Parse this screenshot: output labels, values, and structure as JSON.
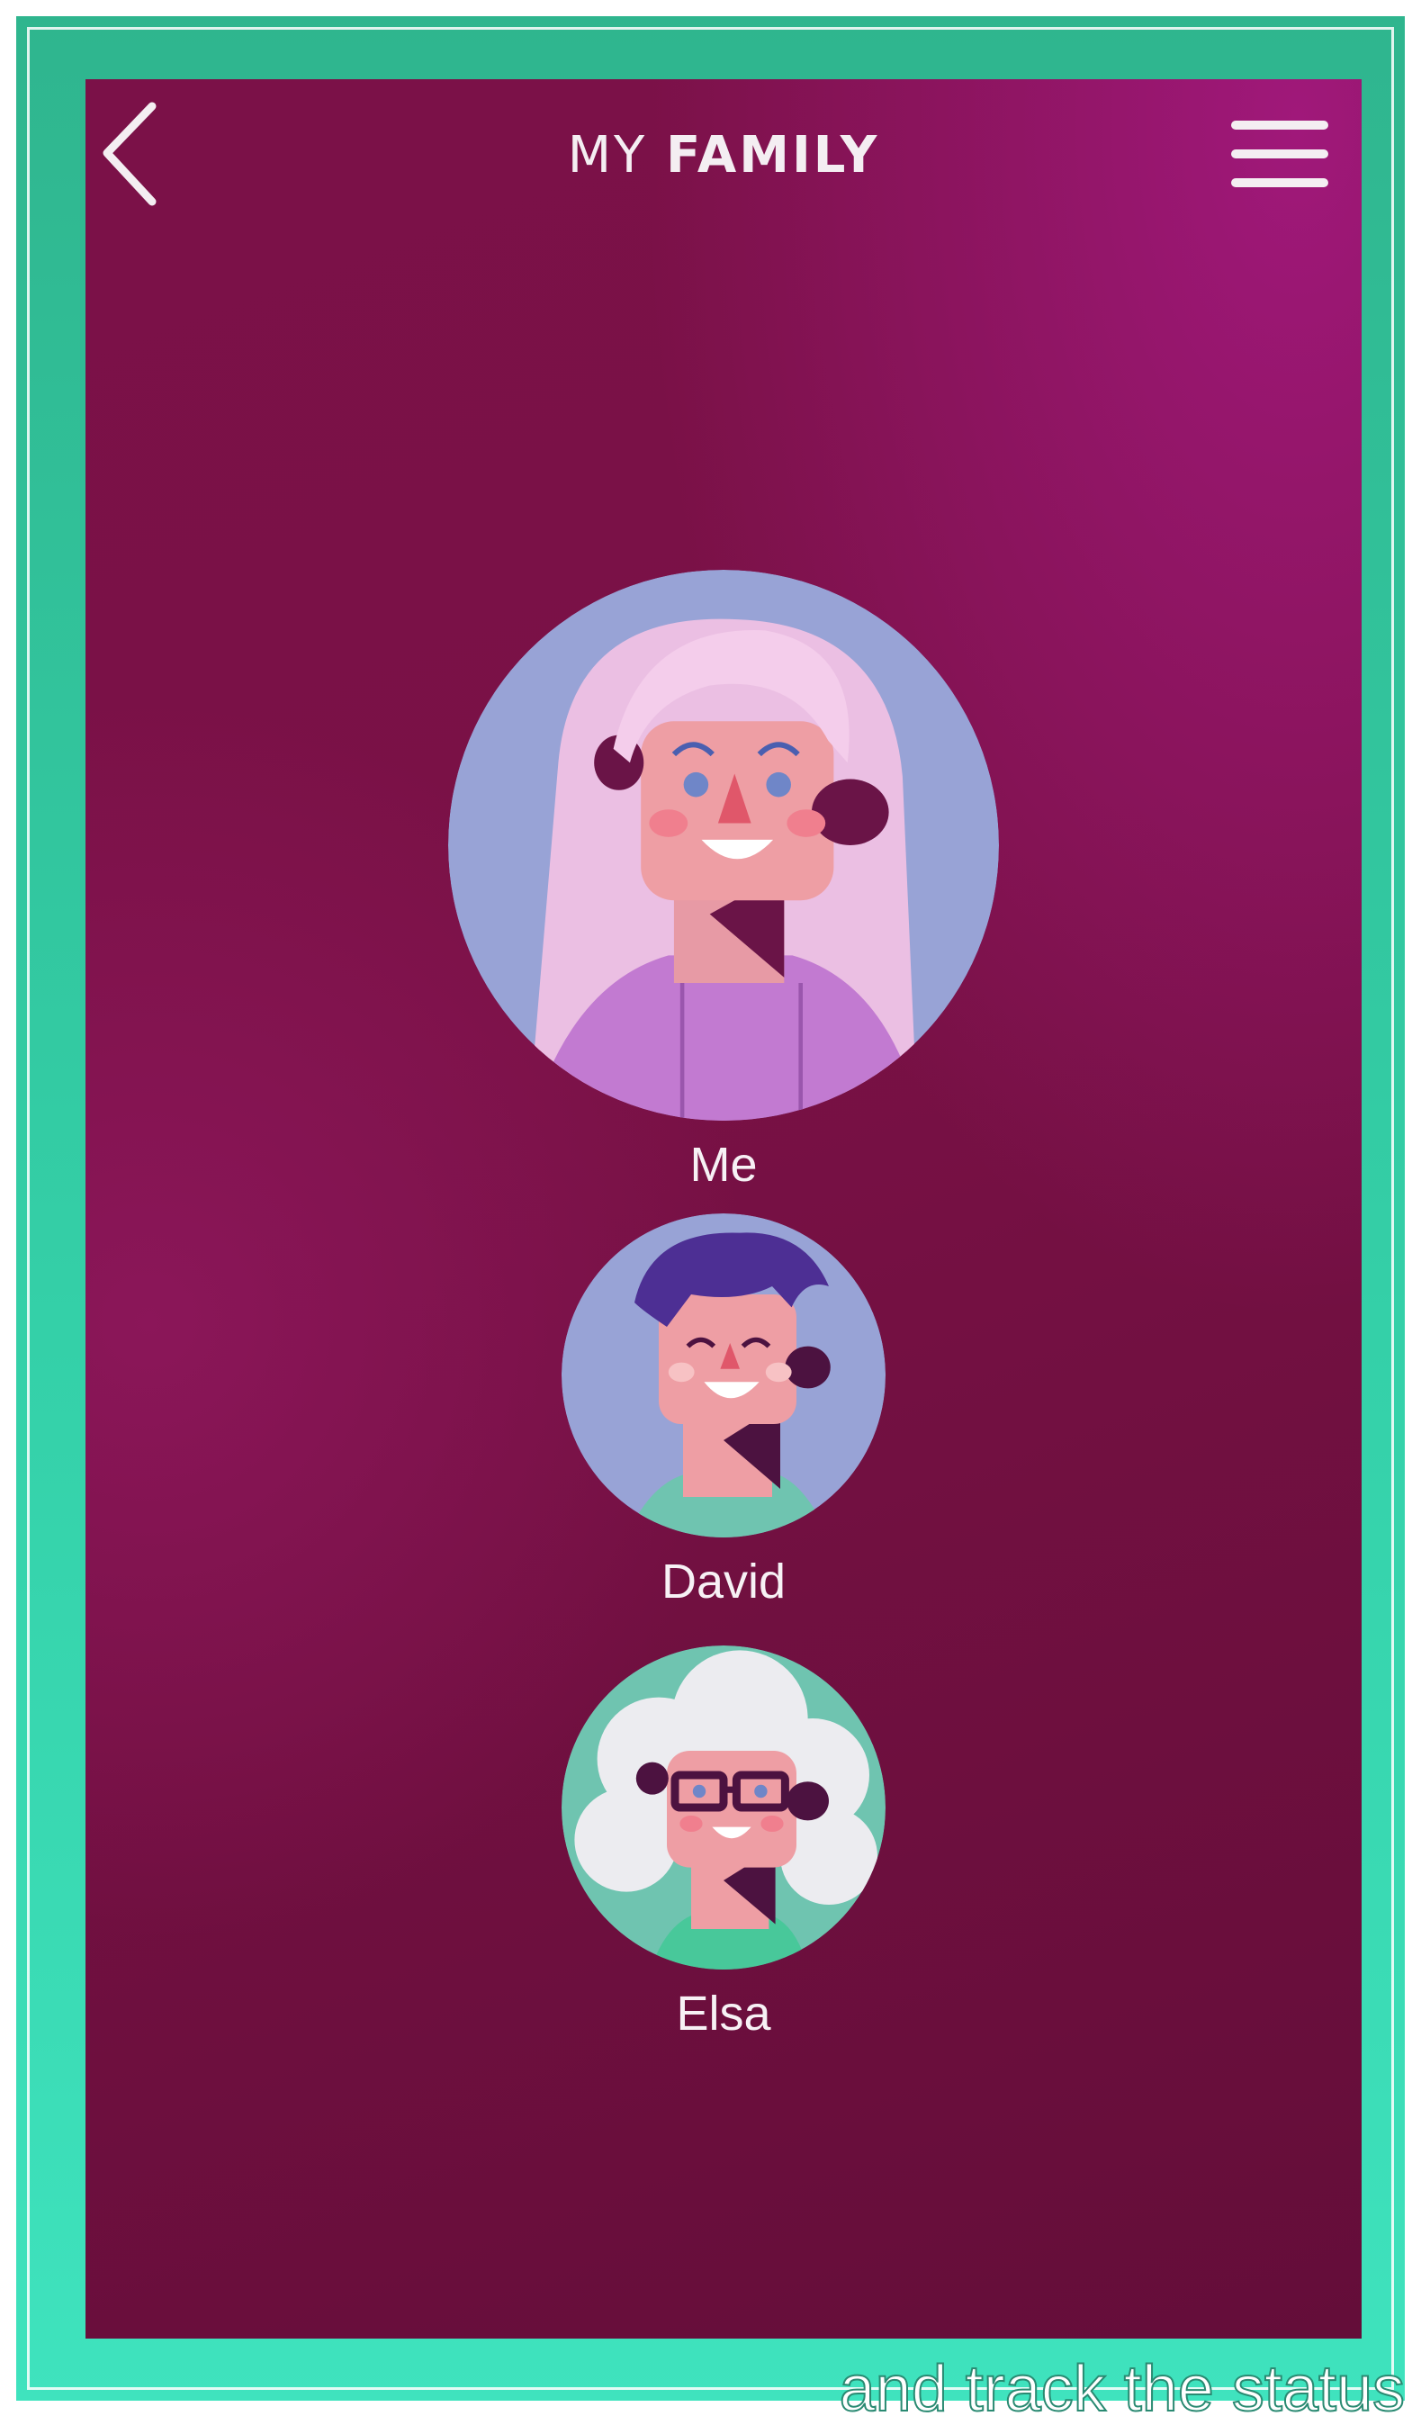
{
  "header": {
    "title_light": "MY",
    "title_bold": "FAMILY",
    "back_icon": "chevron-left-icon",
    "menu_icon": "hamburger-menu-icon"
  },
  "members": [
    {
      "name": "Me"
    },
    {
      "name": "David"
    },
    {
      "name": "Elsa"
    }
  ],
  "caption": "and track the status",
  "colors": {
    "frame": "#34d0a8",
    "screen": "#7a1146",
    "text": "#f4eef2",
    "avatar_bg": "#98a3d6"
  }
}
